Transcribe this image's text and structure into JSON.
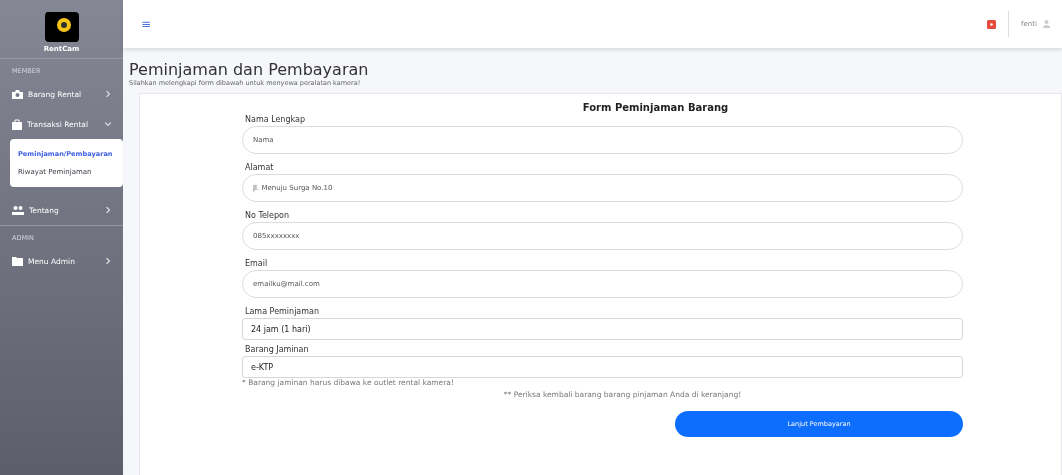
{
  "sidebar": {
    "logo_text": "RentCam",
    "sections": [
      {
        "heading": "MEMBER",
        "items": [
          {
            "label": "Barang Rental",
            "kind": "camera",
            "expanded": false
          },
          {
            "label": "Transaksi Rental",
            "kind": "bag",
            "expanded": true,
            "children": [
              {
                "label": "Peminjaman/Pembayaran",
                "selected": true
              },
              {
                "label": "Riwayat Peminjaman",
                "selected": false
              }
            ]
          },
          {
            "label": "Tentang",
            "kind": "users",
            "expanded": false
          }
        ]
      },
      {
        "heading": "ADMIN",
        "items": [
          {
            "label": "Menu Admin",
            "kind": "folder",
            "expanded": false
          }
        ]
      }
    ]
  },
  "topbar": {
    "menu_icon": "≡",
    "user": "fenti"
  },
  "header": {
    "title": "Peminjaman dan Pembayaran",
    "subtitle": "Silahkan melengkapi form dibawah untuk menyewa peralatan kamera!"
  },
  "form": {
    "title": "Form Peminjaman Barang",
    "fields": [
      {
        "kind": "text",
        "label": "Nama Lengkap",
        "placeholder": "Nama"
      },
      {
        "kind": "text",
        "label": "Alamat",
        "placeholder": "Jl. Menuju Surga No.10"
      },
      {
        "kind": "text",
        "label": "No Telepon",
        "placeholder": "085xxxxxxxx"
      },
      {
        "kind": "text",
        "label": "Email",
        "placeholder": "emailku@mail.com"
      },
      {
        "kind": "select",
        "label": "Lama Peminjaman",
        "value": "24 jam (1 hari)"
      },
      {
        "kind": "select",
        "label": "Barang Jaminan",
        "value": "e-KTP"
      }
    ],
    "note": "* Barang jaminan harus dibawa ke outlet rental kamera!",
    "note2": "** Periksa kembali barang barang pinjaman Anda di keranjang!",
    "submit": "Lanjut Pembayaran"
  }
}
